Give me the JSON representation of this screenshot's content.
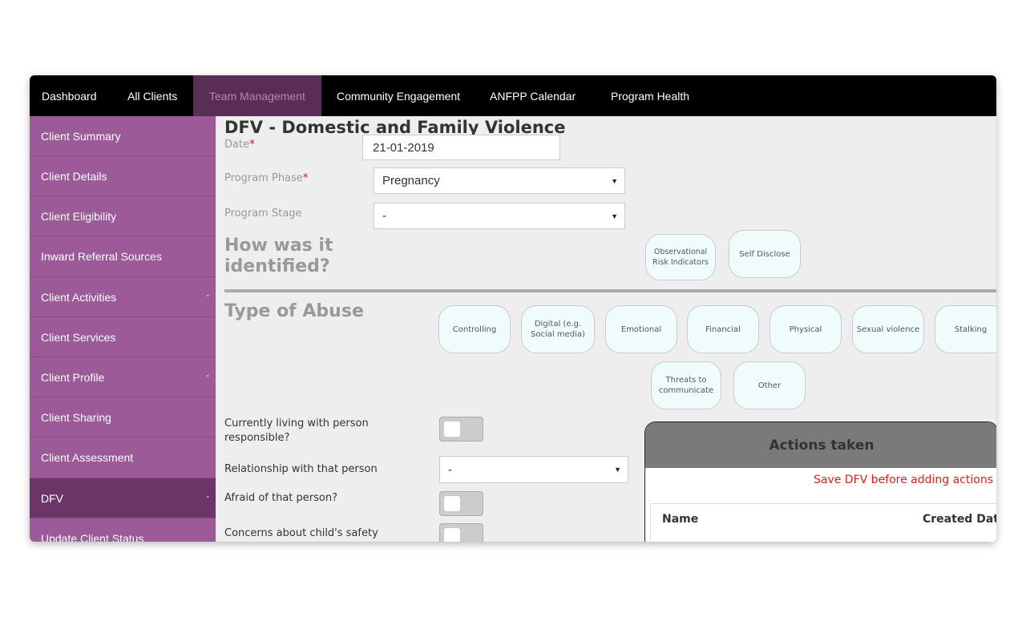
{
  "nav": {
    "items": [
      "Dashboard",
      "All Clients",
      "Team Management",
      "Community Engagement",
      "ANFPP Calendar",
      "Program Health"
    ],
    "active": "Team Management"
  },
  "sidebar": {
    "items": [
      {
        "label": "Client Summary"
      },
      {
        "label": "Client Details"
      },
      {
        "label": "Client Eligibility"
      },
      {
        "label": "Inward Referral Sources"
      },
      {
        "label": "Client Activities",
        "chevron": "-"
      },
      {
        "label": "Client Services"
      },
      {
        "label": "Client Profile",
        "chevron": "-"
      },
      {
        "label": "Client Sharing"
      },
      {
        "label": "Client Assessment"
      },
      {
        "label": "DFV",
        "chevron": "-"
      },
      {
        "label": "Update Client Status"
      }
    ],
    "active": "DFV"
  },
  "form": {
    "title": "DFV - Domestic and Family Violence",
    "date": {
      "label": "Date",
      "required": "*",
      "value": "21-01-2019"
    },
    "program_phase": {
      "label": "Program Phase",
      "required": "*",
      "value": "Pregnancy"
    },
    "program_stage": {
      "label": "Program Stage",
      "value": "-"
    },
    "identified": {
      "heading_line1": "How was it",
      "heading_line2": "identified?",
      "options": [
        "Observational Risk Indicators",
        "Self Disclose"
      ]
    },
    "abuse": {
      "heading": "Type of Abuse",
      "options": [
        "Controlling",
        "Digital (e.g. Social media)",
        "Emotional",
        "Financial",
        "Physical",
        "Sexual violence",
        "Stalking",
        "Threats to communicate",
        "Other"
      ]
    },
    "questions": {
      "living_with_line1": "Currently living with person",
      "living_with_line2": "responsible?",
      "relationship": "Relationship with that person",
      "relationship_value": "-",
      "afraid": "Afraid of that person?",
      "child_safety": "Concerns about child's safety"
    }
  },
  "actions": {
    "title": "Actions taken",
    "warning": "Save DFV before adding actions",
    "columns": [
      "Name",
      "Created Date"
    ]
  },
  "colors": {
    "nav_bg": "#000000",
    "nav_active_bg": "#5a2d54",
    "sidebar_bg": "#9c5a98",
    "sidebar_active_bg": "#6c3568",
    "required": "#d01515",
    "warning": "#e02020"
  },
  "icons": {
    "dropdown": "caret-down-icon",
    "sidebar_expand": "minus"
  }
}
